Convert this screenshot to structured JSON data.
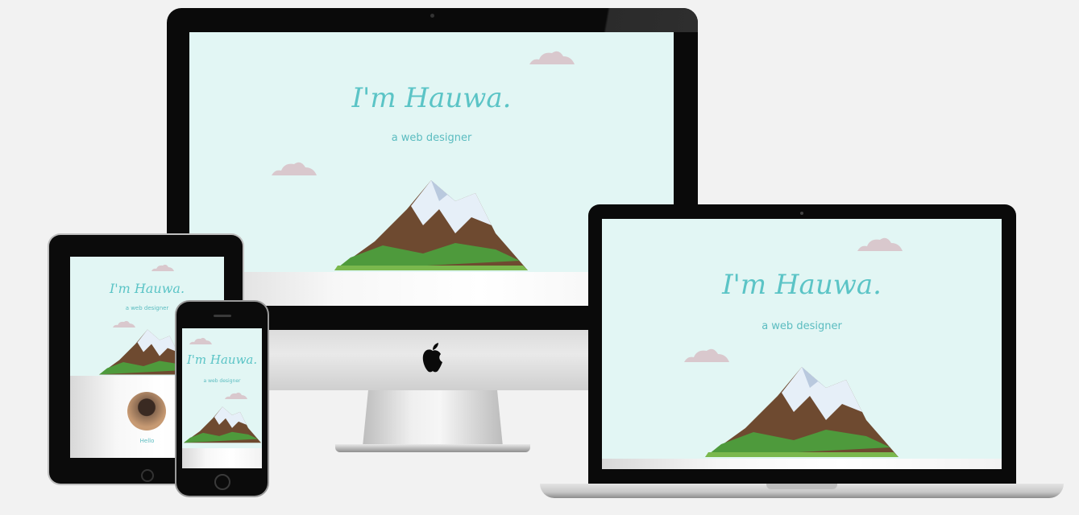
{
  "site": {
    "title": "I'm Hauwa.",
    "subtitle": "a web designer",
    "about_heading": "Hello"
  },
  "colors": {
    "background": "#f2f2f2",
    "sky": "#e2f6f4",
    "title": "#5bc4c6",
    "cloud": "#d9c8cd"
  },
  "icons": {
    "apple_logo": "apple-logo-icon"
  }
}
